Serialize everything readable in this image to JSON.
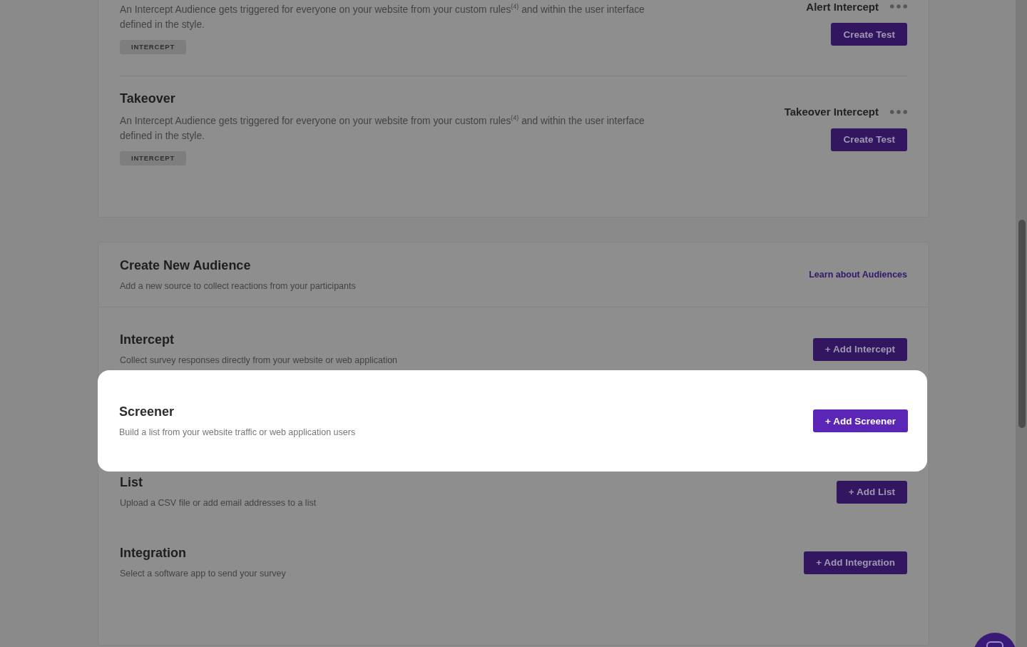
{
  "intercept_rows": [
    {
      "description": "An Intercept Audience gets triggered for everyone on your website from your custom rules$^{(4)}$ and within the user interface defined in the style.",
      "badge": "INTERCEPT",
      "intercept_name": "Alert Intercept",
      "button": "Create Test"
    },
    {
      "title": "Takeover",
      "description": "An Intercept Audience gets triggered for everyone on your website from your custom rules$^{(4)}$ and within the user interface defined in the style.",
      "badge": "INTERCEPT",
      "intercept_name": "Takeover Intercept",
      "button": "Create Test"
    }
  ],
  "create_new_audience": {
    "title": "Create New Audience",
    "subtitle": "Add a new source to collect reactions from your participants",
    "link": "Learn about Audiences",
    "sources": [
      {
        "title": "Intercept",
        "description": "Collect survey responses directly from your website or web application",
        "button": "+ Add Intercept",
        "highlighted": false
      },
      {
        "title": "Screener",
        "description": "Build a list from your website traffic or web application users",
        "button": "+ Add Screener",
        "highlighted": true
      },
      {
        "title": "List",
        "description": "Upload a CSV file or add email addresses to a list",
        "button": "+ Add List",
        "highlighted": false
      },
      {
        "title": "Integration",
        "description": "Select a software app to send your survey",
        "button": "+ Add Integration",
        "highlighted": false
      }
    ]
  }
}
